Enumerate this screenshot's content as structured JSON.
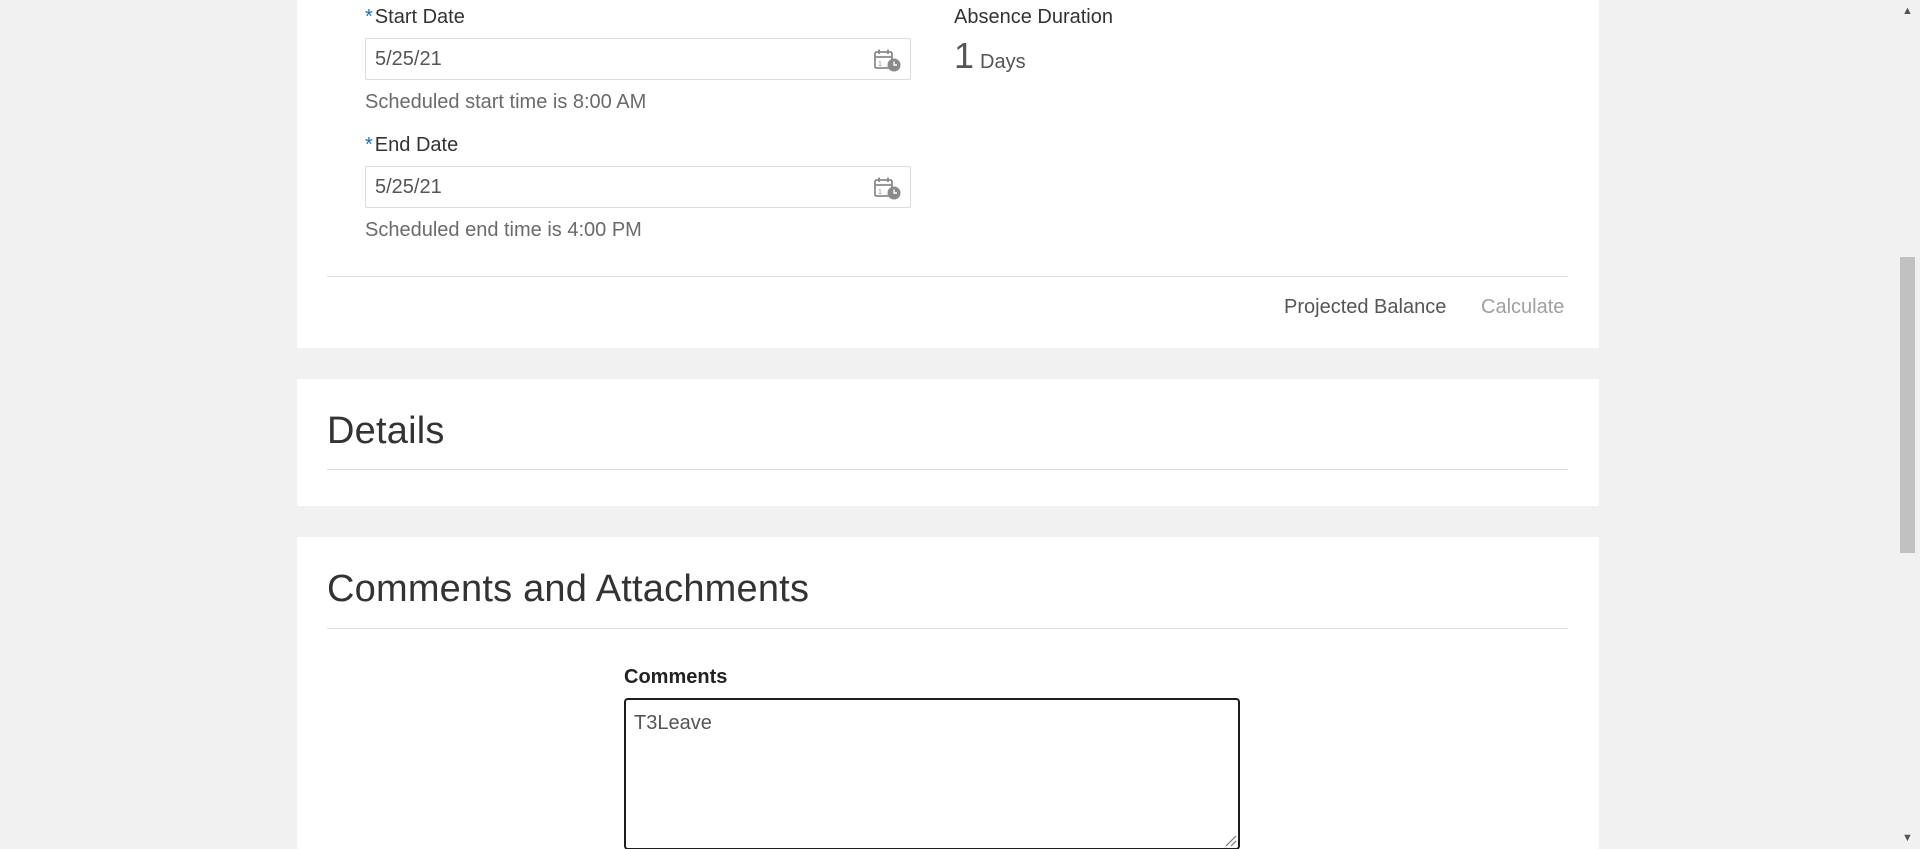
{
  "dates": {
    "start": {
      "required_marker": "*",
      "label": "Start Date",
      "value": "5/25/21",
      "helper": "Scheduled start time is 8:00 AM"
    },
    "end": {
      "required_marker": "*",
      "label": "End Date",
      "value": "5/25/21",
      "helper": "Scheduled end time is 4:00 PM"
    },
    "duration": {
      "label": "Absence Duration",
      "value": "1",
      "unit": "Days"
    },
    "projected_balance_label": "Projected Balance",
    "calculate_label": "Calculate"
  },
  "details": {
    "title": "Details"
  },
  "comments_section": {
    "title": "Comments and Attachments",
    "comments_label": "Comments",
    "comments_value": "T3Leave"
  },
  "icons": {
    "date_picker": "calendar-clock-icon",
    "scroll_up": "arrow-up-icon",
    "scroll_down": "arrow-down-icon",
    "resize": "resize-grip-icon"
  },
  "colors": {
    "required": "#1a6cb4",
    "page_background": "#f1f1f1",
    "disabled_link": "#a0a0a0"
  }
}
